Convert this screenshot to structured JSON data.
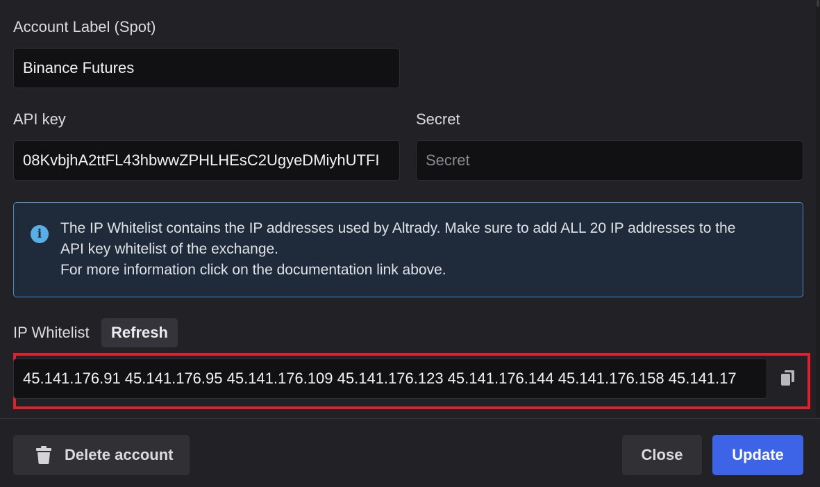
{
  "form": {
    "account_label": {
      "label": "Account Label (Spot)",
      "value": "Binance Futures"
    },
    "api_key": {
      "label": "API key",
      "value": "08KvbjhA2ttFL43hbwwZPHLHEsC2UgyeDMiyhUTFI"
    },
    "secret": {
      "label": "Secret",
      "value": "",
      "placeholder": "Secret"
    }
  },
  "info": {
    "icon": "info-icon",
    "color": "#4a8fc4",
    "lines": [
      "The IP Whitelist contains the IP addresses used by Altrady. Make sure to add ALL 20 IP addresses to the",
      "API key whitelist of the exchange.",
      "For more information click on the documentation link above."
    ]
  },
  "ip_whitelist": {
    "label": "IP Whitelist",
    "refresh_label": "Refresh",
    "value": "45.141.176.91 45.141.176.95 45.141.176.109 45.141.176.123 45.141.176.144 45.141.176.158 45.141.17",
    "copy_icon": "copy-icon",
    "highlight_color": "#e0202a"
  },
  "footer": {
    "delete_label": "Delete account",
    "delete_icon": "trash-icon",
    "close_label": "Close",
    "update_label": "Update",
    "accent_color": "#3d63e6"
  }
}
